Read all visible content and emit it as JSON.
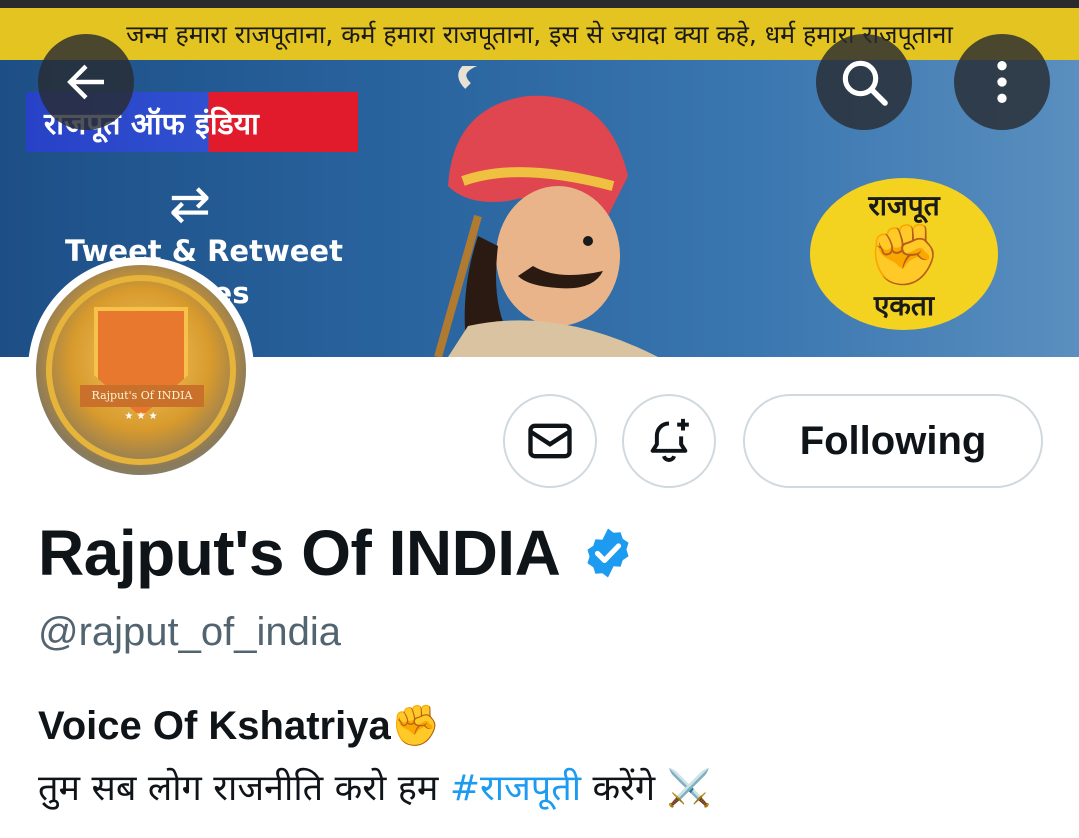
{
  "banner": {
    "ticker_text": "जन्म हमारा राजपूताना, कर्म हमारा राजपूताना, इस से ज्यादा क्या कहे, धर्म हमारा राजपूताना",
    "ribbon_text": "राजपूत ऑफ इंडिया",
    "retweet_glyph": "⇄",
    "promo_line1": "Tweet & Retweet",
    "promo_line2": "times",
    "badge_top": "राजपूत",
    "badge_fist": "✊",
    "badge_bottom": "एकता"
  },
  "avatar": {
    "label": "Rajput's Of INDIA",
    "stars": "★ ★ ★"
  },
  "actions": {
    "following_label": "Following"
  },
  "profile": {
    "display_name": "Rajput's Of INDIA",
    "handle": "@rajput_of_india",
    "bio_title": "Voice Of Kshatriya✊",
    "bio_prefix": "तुम सब लोग राजनीति करो हम ",
    "bio_hashtag": "#राजपूती",
    "bio_suffix": " करेंगे ⚔️"
  },
  "colors": {
    "accent": "#1d9bf0",
    "ticker": "#e3c420",
    "verified": "#1d9bf0",
    "text_primary": "#0f1419",
    "text_secondary": "#536471"
  },
  "icons": {
    "back": "arrow-left-icon",
    "search": "search-icon",
    "more": "more-vertical-icon",
    "message": "envelope-icon",
    "notify": "bell-plus-icon",
    "verified": "verified-badge-icon"
  }
}
